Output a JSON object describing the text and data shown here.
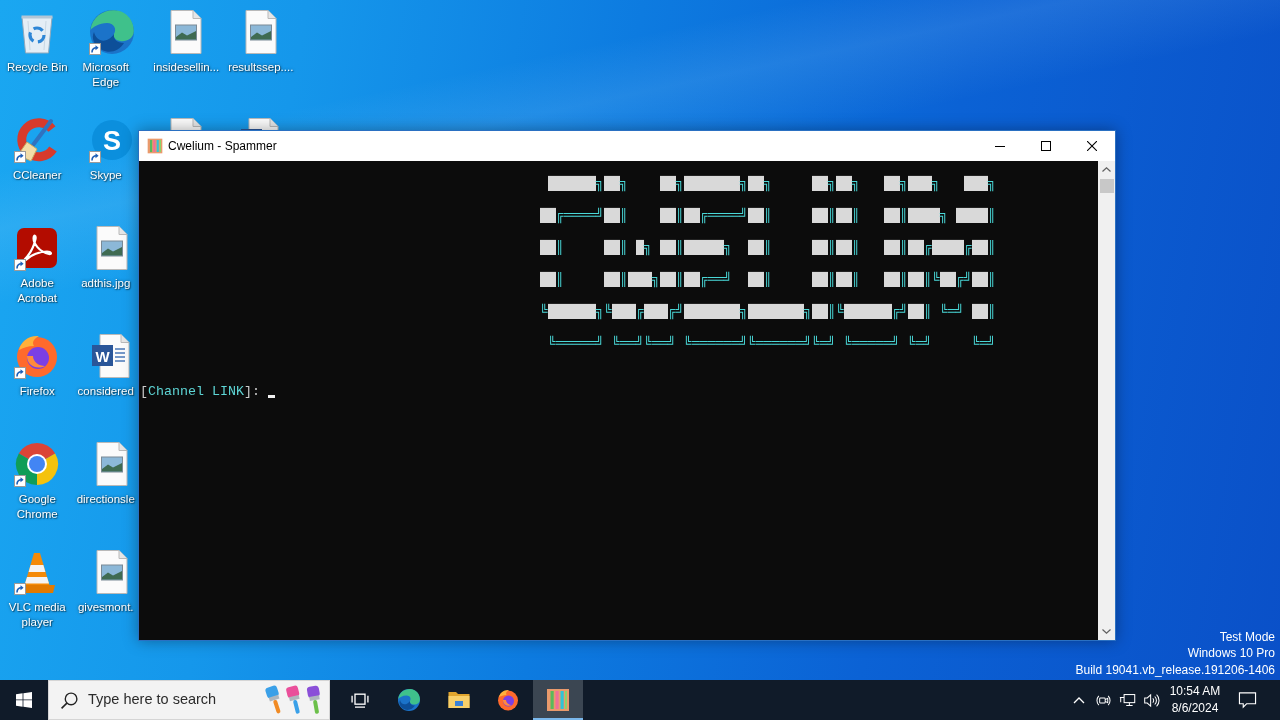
{
  "desktop": {
    "icon_columns": [
      [
        {
          "label": "Recycle Bin",
          "kind": "recycle-bin",
          "shortcut": false
        },
        {
          "label": "CCleaner",
          "kind": "ccleaner",
          "shortcut": true
        },
        {
          "label": "Adobe Acrobat",
          "kind": "acrobat",
          "shortcut": true
        },
        {
          "label": "Firefox",
          "kind": "firefox",
          "shortcut": true
        },
        {
          "label": "Google Chrome",
          "kind": "chrome",
          "shortcut": true
        },
        {
          "label": "VLC media player",
          "kind": "vlc",
          "shortcut": true
        }
      ],
      [
        {
          "label": "Microsoft Edge",
          "kind": "edge",
          "shortcut": true
        },
        {
          "label": "Skype",
          "kind": "skype",
          "shortcut": true,
          "logo_text": "S"
        },
        {
          "label": "adthis.jpg",
          "kind": "image-file",
          "shortcut": false
        },
        {
          "label": "considered",
          "kind": "word-file",
          "shortcut": false,
          "logo_text": "W"
        },
        {
          "label": "directionsle",
          "kind": "image-file",
          "shortcut": false
        },
        {
          "label": "givesmont.",
          "kind": "image-file",
          "shortcut": false
        }
      ],
      [
        {
          "label": "insidesellin...",
          "kind": "image-file",
          "shortcut": false
        },
        {
          "kind": "image-file",
          "shortcut": false
        }
      ],
      [
        {
          "label": "resultssep....",
          "kind": "image-file",
          "shortcut": false
        },
        {
          "kind": "word-file",
          "shortcut": false
        }
      ]
    ],
    "system_info": [
      "Test Mode",
      "Windows 10 Pro",
      "Build 19041.vb_release.191206-1406"
    ]
  },
  "window": {
    "title": "Cwelium - Spammer",
    "console": {
      "banner": [
        [
          {
            "kind": "fill",
            "text": " ██████"
          },
          {
            "kind": "edge",
            "text": "╗"
          },
          {
            "kind": "fill",
            "text": "██"
          },
          {
            "kind": "edge",
            "text": "╗    "
          },
          {
            "kind": "fill",
            "text": "██"
          },
          {
            "kind": "edge",
            "text": "╗"
          },
          {
            "kind": "fill",
            "text": "███████"
          },
          {
            "kind": "edge",
            "text": "╗"
          },
          {
            "kind": "fill",
            "text": "██"
          },
          {
            "kind": "edge",
            "text": "╗     "
          },
          {
            "kind": "fill",
            "text": "██"
          },
          {
            "kind": "edge",
            "text": "╗"
          },
          {
            "kind": "fill",
            "text": "██"
          },
          {
            "kind": "edge",
            "text": "╗   "
          },
          {
            "kind": "fill",
            "text": "██"
          },
          {
            "kind": "edge",
            "text": "╗"
          },
          {
            "kind": "fill",
            "text": "███"
          },
          {
            "kind": "edge",
            "text": "╗   "
          },
          {
            "kind": "fill",
            "text": "███"
          },
          {
            "kind": "edge",
            "text": "╗"
          }
        ],
        [
          {
            "kind": "fill",
            "text": "██"
          },
          {
            "kind": "edge",
            "text": "╔════╝"
          },
          {
            "kind": "fill",
            "text": "██"
          },
          {
            "kind": "edge",
            "text": "║    "
          },
          {
            "kind": "fill",
            "text": "██"
          },
          {
            "kind": "edge",
            "text": "║"
          },
          {
            "kind": "fill",
            "text": "██"
          },
          {
            "kind": "edge",
            "text": "╔════╝"
          },
          {
            "kind": "fill",
            "text": "██"
          },
          {
            "kind": "edge",
            "text": "║     "
          },
          {
            "kind": "fill",
            "text": "██"
          },
          {
            "kind": "edge",
            "text": "║"
          },
          {
            "kind": "fill",
            "text": "██"
          },
          {
            "kind": "edge",
            "text": "║   "
          },
          {
            "kind": "fill",
            "text": "██"
          },
          {
            "kind": "edge",
            "text": "║"
          },
          {
            "kind": "fill",
            "text": "████"
          },
          {
            "kind": "edge",
            "text": "╗ "
          },
          {
            "kind": "fill",
            "text": "████"
          },
          {
            "kind": "edge",
            "text": "║"
          }
        ],
        [
          {
            "kind": "fill",
            "text": "██"
          },
          {
            "kind": "edge",
            "text": "║     "
          },
          {
            "kind": "fill",
            "text": "██"
          },
          {
            "kind": "edge",
            "text": "║ "
          },
          {
            "kind": "fill",
            "text": "█"
          },
          {
            "kind": "edge",
            "text": "╗ "
          },
          {
            "kind": "fill",
            "text": "██"
          },
          {
            "kind": "edge",
            "text": "║"
          },
          {
            "kind": "fill",
            "text": "█████"
          },
          {
            "kind": "edge",
            "text": "╗  "
          },
          {
            "kind": "fill",
            "text": "██"
          },
          {
            "kind": "edge",
            "text": "║     "
          },
          {
            "kind": "fill",
            "text": "██"
          },
          {
            "kind": "edge",
            "text": "║"
          },
          {
            "kind": "fill",
            "text": "██"
          },
          {
            "kind": "edge",
            "text": "║   "
          },
          {
            "kind": "fill",
            "text": "██"
          },
          {
            "kind": "edge",
            "text": "║"
          },
          {
            "kind": "fill",
            "text": "██"
          },
          {
            "kind": "edge",
            "text": "╔"
          },
          {
            "kind": "fill",
            "text": "████"
          },
          {
            "kind": "edge",
            "text": "╔"
          },
          {
            "kind": "fill",
            "text": "██"
          },
          {
            "kind": "edge",
            "text": "║"
          }
        ],
        [
          {
            "kind": "fill",
            "text": "██"
          },
          {
            "kind": "edge",
            "text": "║     "
          },
          {
            "kind": "fill",
            "text": "██"
          },
          {
            "kind": "edge",
            "text": "║"
          },
          {
            "kind": "fill",
            "text": "███"
          },
          {
            "kind": "edge",
            "text": "╗"
          },
          {
            "kind": "fill",
            "text": "██"
          },
          {
            "kind": "edge",
            "text": "║"
          },
          {
            "kind": "fill",
            "text": "██"
          },
          {
            "kind": "edge",
            "text": "╔══╝  "
          },
          {
            "kind": "fill",
            "text": "██"
          },
          {
            "kind": "edge",
            "text": "║     "
          },
          {
            "kind": "fill",
            "text": "██"
          },
          {
            "kind": "edge",
            "text": "║"
          },
          {
            "kind": "fill",
            "text": "██"
          },
          {
            "kind": "edge",
            "text": "║   "
          },
          {
            "kind": "fill",
            "text": "██"
          },
          {
            "kind": "edge",
            "text": "║"
          },
          {
            "kind": "fill",
            "text": "██"
          },
          {
            "kind": "edge",
            "text": "║╚"
          },
          {
            "kind": "fill",
            "text": "██"
          },
          {
            "kind": "edge",
            "text": "╔╝"
          },
          {
            "kind": "fill",
            "text": "██"
          },
          {
            "kind": "edge",
            "text": "║"
          }
        ],
        [
          {
            "kind": "edge",
            "text": "╚"
          },
          {
            "kind": "fill",
            "text": "██████"
          },
          {
            "kind": "edge",
            "text": "╗╚"
          },
          {
            "kind": "fill",
            "text": "███"
          },
          {
            "kind": "edge",
            "text": "╔"
          },
          {
            "kind": "fill",
            "text": "███"
          },
          {
            "kind": "edge",
            "text": "╔╝"
          },
          {
            "kind": "fill",
            "text": "███████"
          },
          {
            "kind": "edge",
            "text": "╗"
          },
          {
            "kind": "fill",
            "text": "███████"
          },
          {
            "kind": "edge",
            "text": "╗"
          },
          {
            "kind": "fill",
            "text": "██"
          },
          {
            "kind": "edge",
            "text": "║╚"
          },
          {
            "kind": "fill",
            "text": "██████"
          },
          {
            "kind": "edge",
            "text": "╔╝"
          },
          {
            "kind": "fill",
            "text": "██"
          },
          {
            "kind": "edge",
            "text": "║ ╚═╝ "
          },
          {
            "kind": "fill",
            "text": "██"
          },
          {
            "kind": "edge",
            "text": "║"
          }
        ],
        [
          {
            "kind": "edge",
            "text": " ╚═════╝ ╚══╝╚══╝ ╚══════╝╚══════╝╚═╝ ╚═════╝ ╚═╝     ╚═╝"
          }
        ]
      ],
      "prompt": [
        {
          "kind": "plain",
          "text": "["
        },
        {
          "kind": "accent",
          "text": "Channel LINK"
        },
        {
          "kind": "plain",
          "text": "]:"
        }
      ]
    }
  },
  "taskbar": {
    "search": {
      "placeholder": "Type here to search"
    },
    "pinned": [
      {
        "kind": "task-view",
        "selected": false
      },
      {
        "kind": "edge",
        "selected": false
      },
      {
        "kind": "explorer",
        "selected": false
      },
      {
        "kind": "firefox",
        "selected": false
      },
      {
        "kind": "cwelium",
        "selected": true
      }
    ],
    "clock": {
      "time": "10:54 AM",
      "date": "8/6/2024"
    }
  }
}
